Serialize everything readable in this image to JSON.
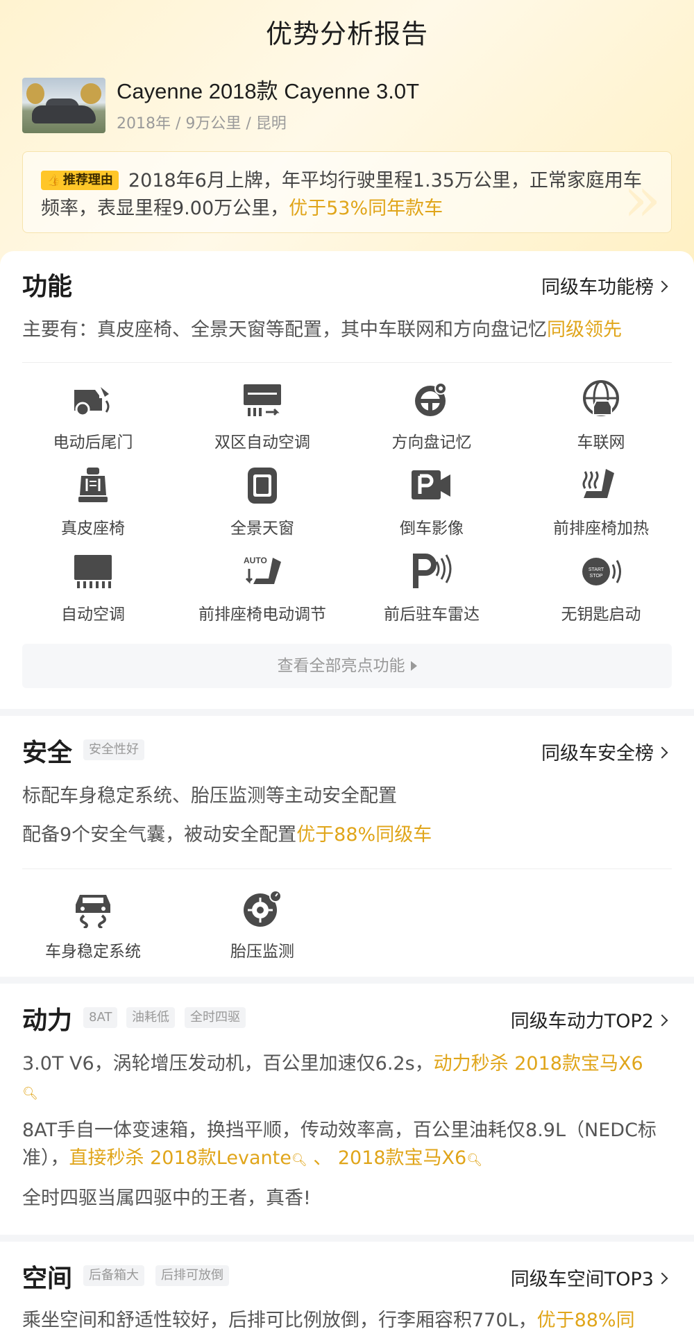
{
  "header": {
    "title": "优势分析报告",
    "car_name": "Cayenne 2018款 Cayenne 3.0T",
    "car_meta": "2018年 / 9万公里 / 昆明",
    "reason_tag": "推荐理由",
    "reason_text": "2018年6月上牌，年平均行驶里程1.35万公里，正常家庭用车频率，表显里程9.00万公里，",
    "reason_highlight": "优于53%同年款车"
  },
  "function": {
    "title": "功能",
    "link": "同级车功能榜",
    "desc": "主要有：真皮座椅、全景天窗等配置，其中车联网和方向盘记忆",
    "desc_highlight": "同级领先",
    "features": [
      {
        "icon": "power-tailgate-icon",
        "label": "电动后尾门"
      },
      {
        "icon": "dual-zone-ac-icon",
        "label": "双区自动空调"
      },
      {
        "icon": "steering-memory-icon",
        "label": "方向盘记忆"
      },
      {
        "icon": "connected-car-icon",
        "label": "车联网"
      },
      {
        "icon": "leather-seat-icon",
        "label": "真皮座椅"
      },
      {
        "icon": "panoramic-sunroof-icon",
        "label": "全景天窗"
      },
      {
        "icon": "reverse-camera-icon",
        "label": "倒车影像"
      },
      {
        "icon": "seat-heating-icon",
        "label": "前排座椅加热"
      },
      {
        "icon": "auto-ac-icon",
        "label": "自动空调"
      },
      {
        "icon": "power-seat-icon",
        "label": "前排座椅电动调节"
      },
      {
        "icon": "parking-radar-icon",
        "label": "前后驻车雷达"
      },
      {
        "icon": "keyless-start-icon",
        "label": "无钥匙启动"
      }
    ],
    "view_all": "查看全部亮点功能",
    "auto_text": "AUTO",
    "start_text": "START",
    "stop_text": "STOP"
  },
  "safety": {
    "title": "安全",
    "tag": "安全性好",
    "link": "同级车安全榜",
    "line1": "标配车身稳定系统、胎压监测等主动安全配置",
    "line2": "配备9个安全气囊，被动安全配置",
    "line2_highlight": "优于88%同级车",
    "features": [
      {
        "icon": "stability-control-icon",
        "label": "车身稳定系统"
      },
      {
        "icon": "tire-pressure-icon",
        "label": "胎压监测"
      }
    ]
  },
  "power": {
    "title": "动力",
    "tags": [
      "8AT",
      "油耗低",
      "全时四驱"
    ],
    "link": "同级车动力TOP2",
    "p1": "3.0T V6，涡轮增压发动机，百公里加速仅6.2s，",
    "p1_highlight": "动力秒杀 2018款宝马X6",
    "p2": "8AT手自一体变速箱，换挡平顺，传动效率高，百公里油耗仅8.9L（NEDC标准），",
    "p2_highlight_a": "直接秒杀 2018款Levante",
    "p2_sep": " 、 ",
    "p2_highlight_b": "2018款宝马X6",
    "p3": "全时四驱当属四驱中的王者，真香!"
  },
  "space": {
    "title": "空间",
    "tags": [
      "后备箱大",
      "后排可放倒"
    ],
    "link": "同级车空间TOP3",
    "desc": "乘坐空间和舒适性较好，后排可比例放倒，行李厢容积770L，",
    "desc_highlight": "优于88%同"
  }
}
